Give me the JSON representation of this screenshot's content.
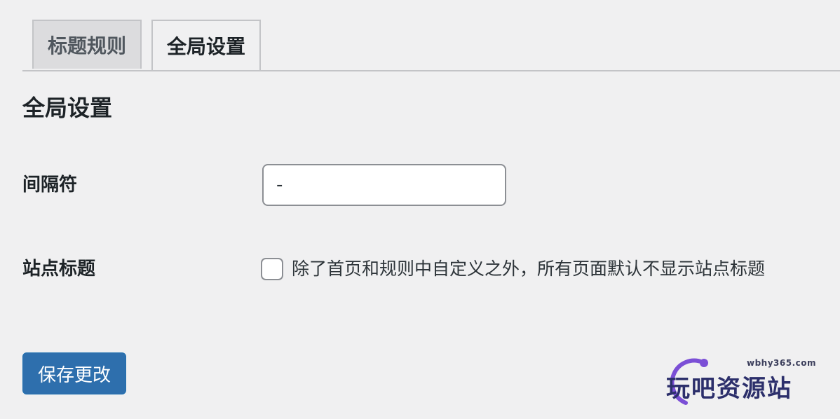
{
  "tabs": [
    {
      "label": "标题规则",
      "active": false
    },
    {
      "label": "全局设置",
      "active": true
    }
  ],
  "section": {
    "title": "全局设置"
  },
  "fields": {
    "separator": {
      "label": "间隔符",
      "value": "-"
    },
    "site_title": {
      "label": "站点标题",
      "checkbox_label": "除了首页和规则中自定义之外，所有页面默认不显示站点标题",
      "checked": false
    }
  },
  "actions": {
    "save_label": "保存更改"
  },
  "watermark": {
    "url": "wbhy365.com",
    "text": "玩吧资源站"
  },
  "colors": {
    "background": "#f0f0f1",
    "primary_button": "#2e6fad",
    "watermark_arc": "#7b4fd6"
  }
}
